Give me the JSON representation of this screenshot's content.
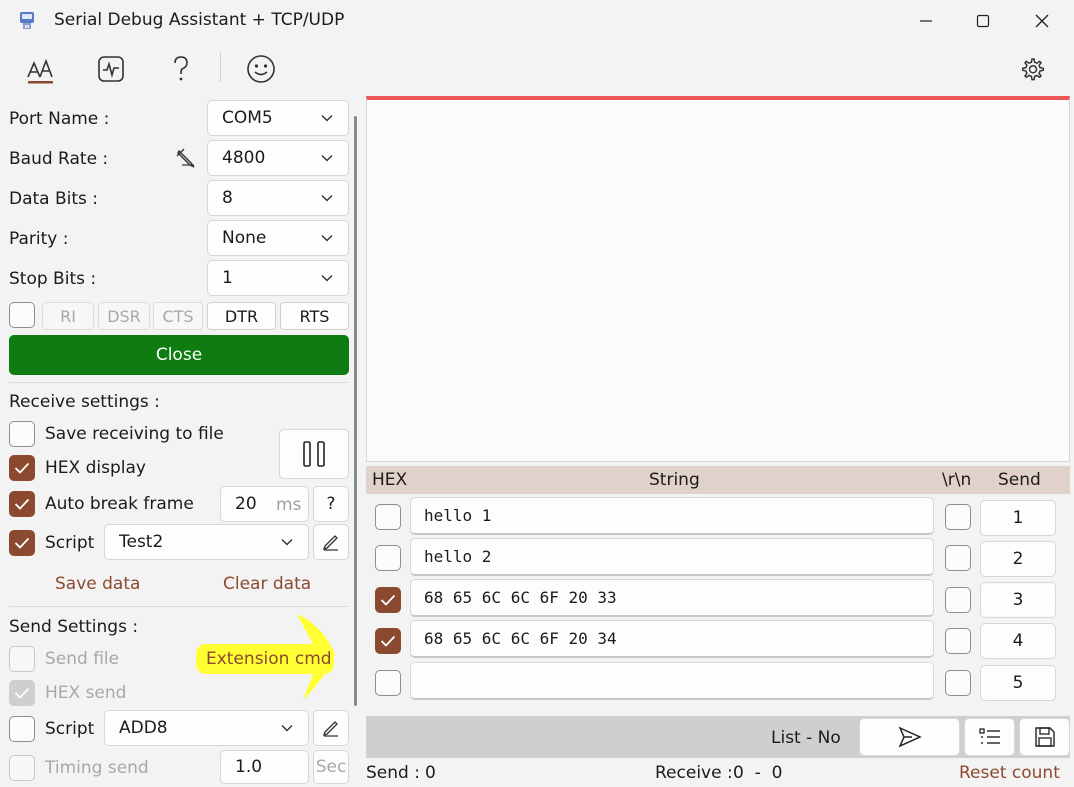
{
  "window": {
    "title": "Serial Debug Assistant + TCP/UDP",
    "controls": [
      "minimize-icon",
      "maximize-icon",
      "close-icon"
    ]
  },
  "toolbar": {
    "tools": [
      "text-style-icon",
      "waveform-icon",
      "help-icon",
      "smiley-icon"
    ],
    "settings_icon": "gear-icon"
  },
  "port": {
    "port_name_label": "Port Name :",
    "port_name_value": "COM5",
    "baud_rate_label": "Baud Rate :",
    "baud_rate_value": "4800",
    "data_bits_label": "Data Bits :",
    "data_bits_value": "8",
    "parity_label": "Parity :",
    "parity_value": "None",
    "stop_bits_label": "Stop Bits :",
    "stop_bits_value": "1",
    "signals": [
      "RI",
      "DSR",
      "CTS",
      "DTR",
      "RTS"
    ],
    "close_label": "Close",
    "accent_color": "#0e7c10"
  },
  "receive": {
    "heading": "Receive settings :",
    "save_to_file": "Save receiving to file",
    "hex_display": "HEX display",
    "auto_break": "Auto break frame",
    "auto_break_value": "20",
    "auto_break_unit": "ms",
    "help_label": "?",
    "script_label": "Script",
    "script_value": "Test2",
    "save_data": "Save data",
    "clear_data": "Clear data"
  },
  "send": {
    "heading": "Send Settings :",
    "send_file": "Send file",
    "extension_cmd": "Extension cmd",
    "hex_send": "HEX send",
    "script_label": "Script",
    "script_value": "ADD8",
    "timing_send": "Timing send",
    "timing_value": "1.0",
    "timing_unit": "Sec"
  },
  "grid": {
    "headers": {
      "hex": "HEX",
      "string": "String",
      "crlf": "\\r\\n",
      "send": "Send"
    },
    "rows": [
      {
        "hex": false,
        "text": "hello 1",
        "crlf": false,
        "send": "1"
      },
      {
        "hex": false,
        "text": "hello 2",
        "crlf": false,
        "send": "2"
      },
      {
        "hex": true,
        "text": "68 65 6C 6C 6F 20 33",
        "crlf": false,
        "send": "3"
      },
      {
        "hex": true,
        "text": "68 65 6C 6C 6F 20 34",
        "crlf": false,
        "send": "4"
      },
      {
        "hex": false,
        "text": "",
        "crlf": false,
        "send": "5"
      }
    ],
    "list_label": "List - No"
  },
  "status": {
    "send_label": "Send :",
    "send_value": "0",
    "receive_label": "Receive :",
    "receive_value": "0  -  0",
    "reset_label": "Reset count"
  },
  "colors": {
    "brand": "#8b4a2f",
    "highlight": "#ffff33"
  }
}
